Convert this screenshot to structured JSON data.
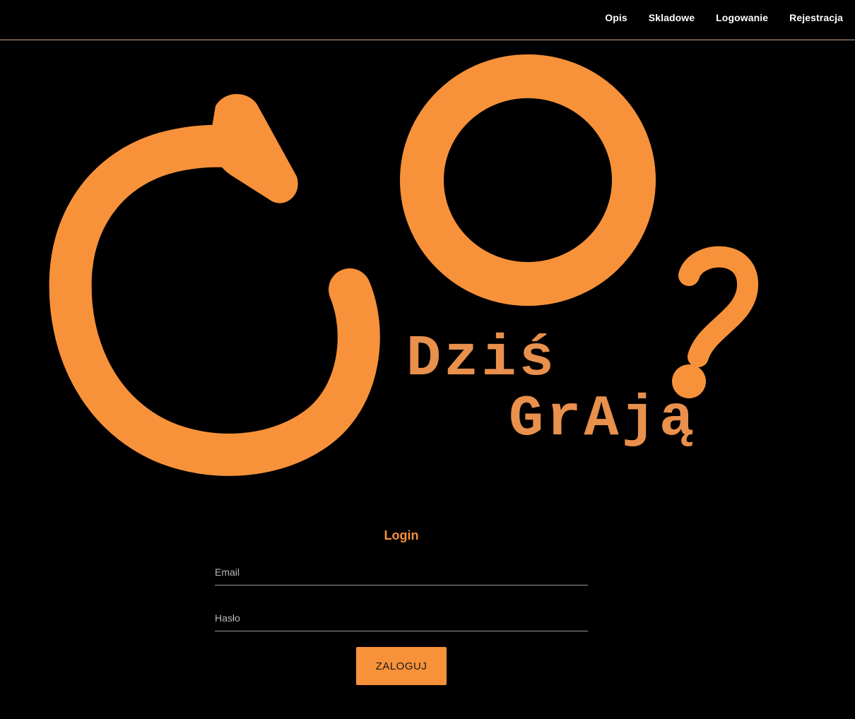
{
  "nav": {
    "items": [
      {
        "label": "Opis"
      },
      {
        "label": "Skladowe"
      },
      {
        "label": "Logowanie"
      },
      {
        "label": "Rejestracja"
      }
    ]
  },
  "logo": {
    "line1": "Dziś",
    "line2": "GrAją",
    "color": "#f7923a"
  },
  "login": {
    "title": "Login",
    "email_placeholder": "Email",
    "password_placeholder": "Hasło",
    "button_label": "ZALOGUJ"
  },
  "colors": {
    "accent": "#f7923a",
    "background": "#000000"
  }
}
